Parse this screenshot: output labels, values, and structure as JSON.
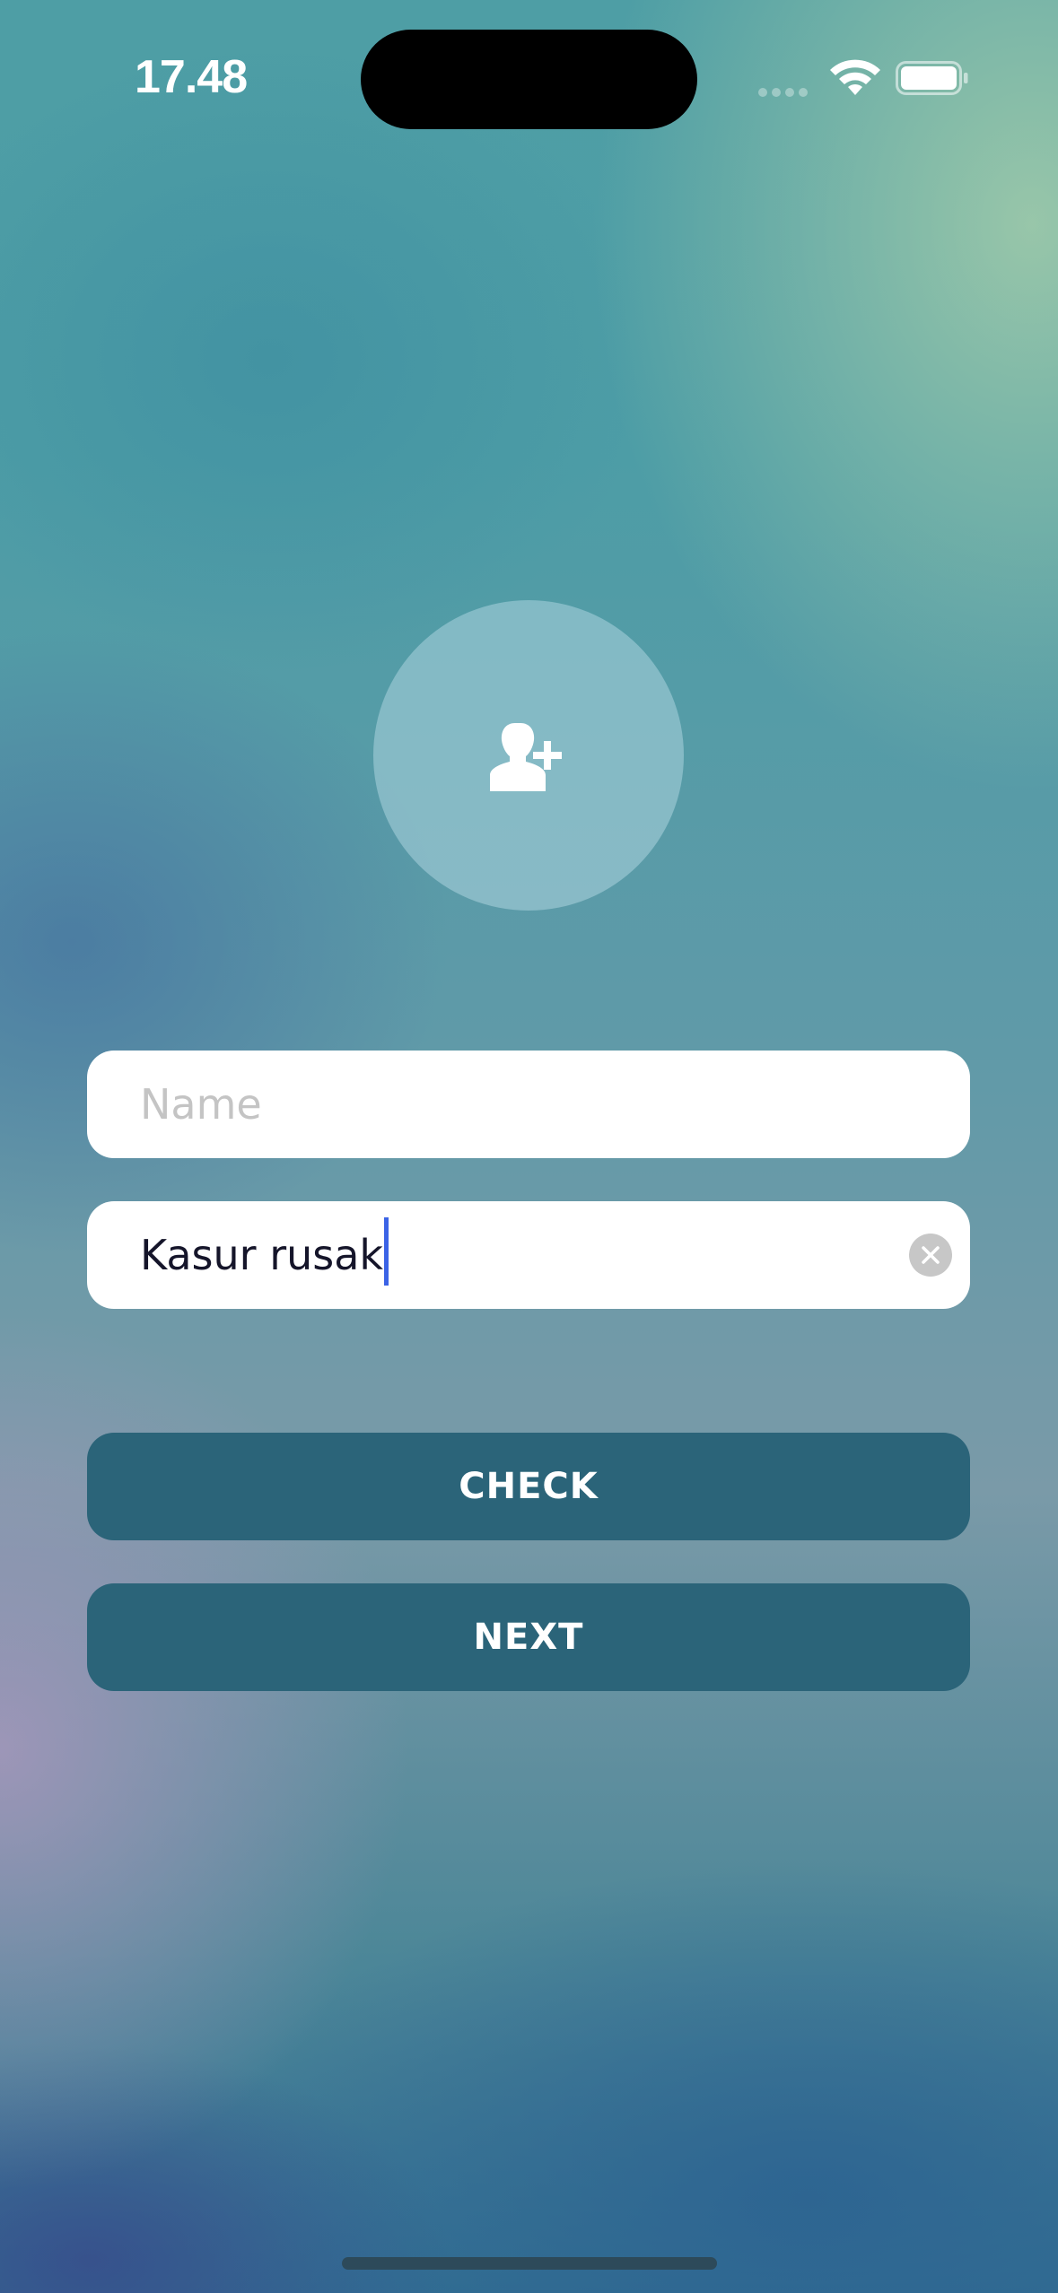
{
  "status_bar": {
    "time": "17.48",
    "signal_icon": "cellular-signal-icon",
    "wifi_icon": "wifi-icon",
    "battery_icon": "battery-icon"
  },
  "avatar": {
    "icon": "add-user-icon"
  },
  "form": {
    "name_placeholder": "Name",
    "name_value": "",
    "description_value": "Kasur rusak",
    "clear_icon": "clear-icon"
  },
  "buttons": {
    "check_label": "CHECK",
    "next_label": "NEXT"
  },
  "colors": {
    "button_bg": "#2b6479",
    "caret": "#3b63e6",
    "field_bg": "#ffffff"
  }
}
